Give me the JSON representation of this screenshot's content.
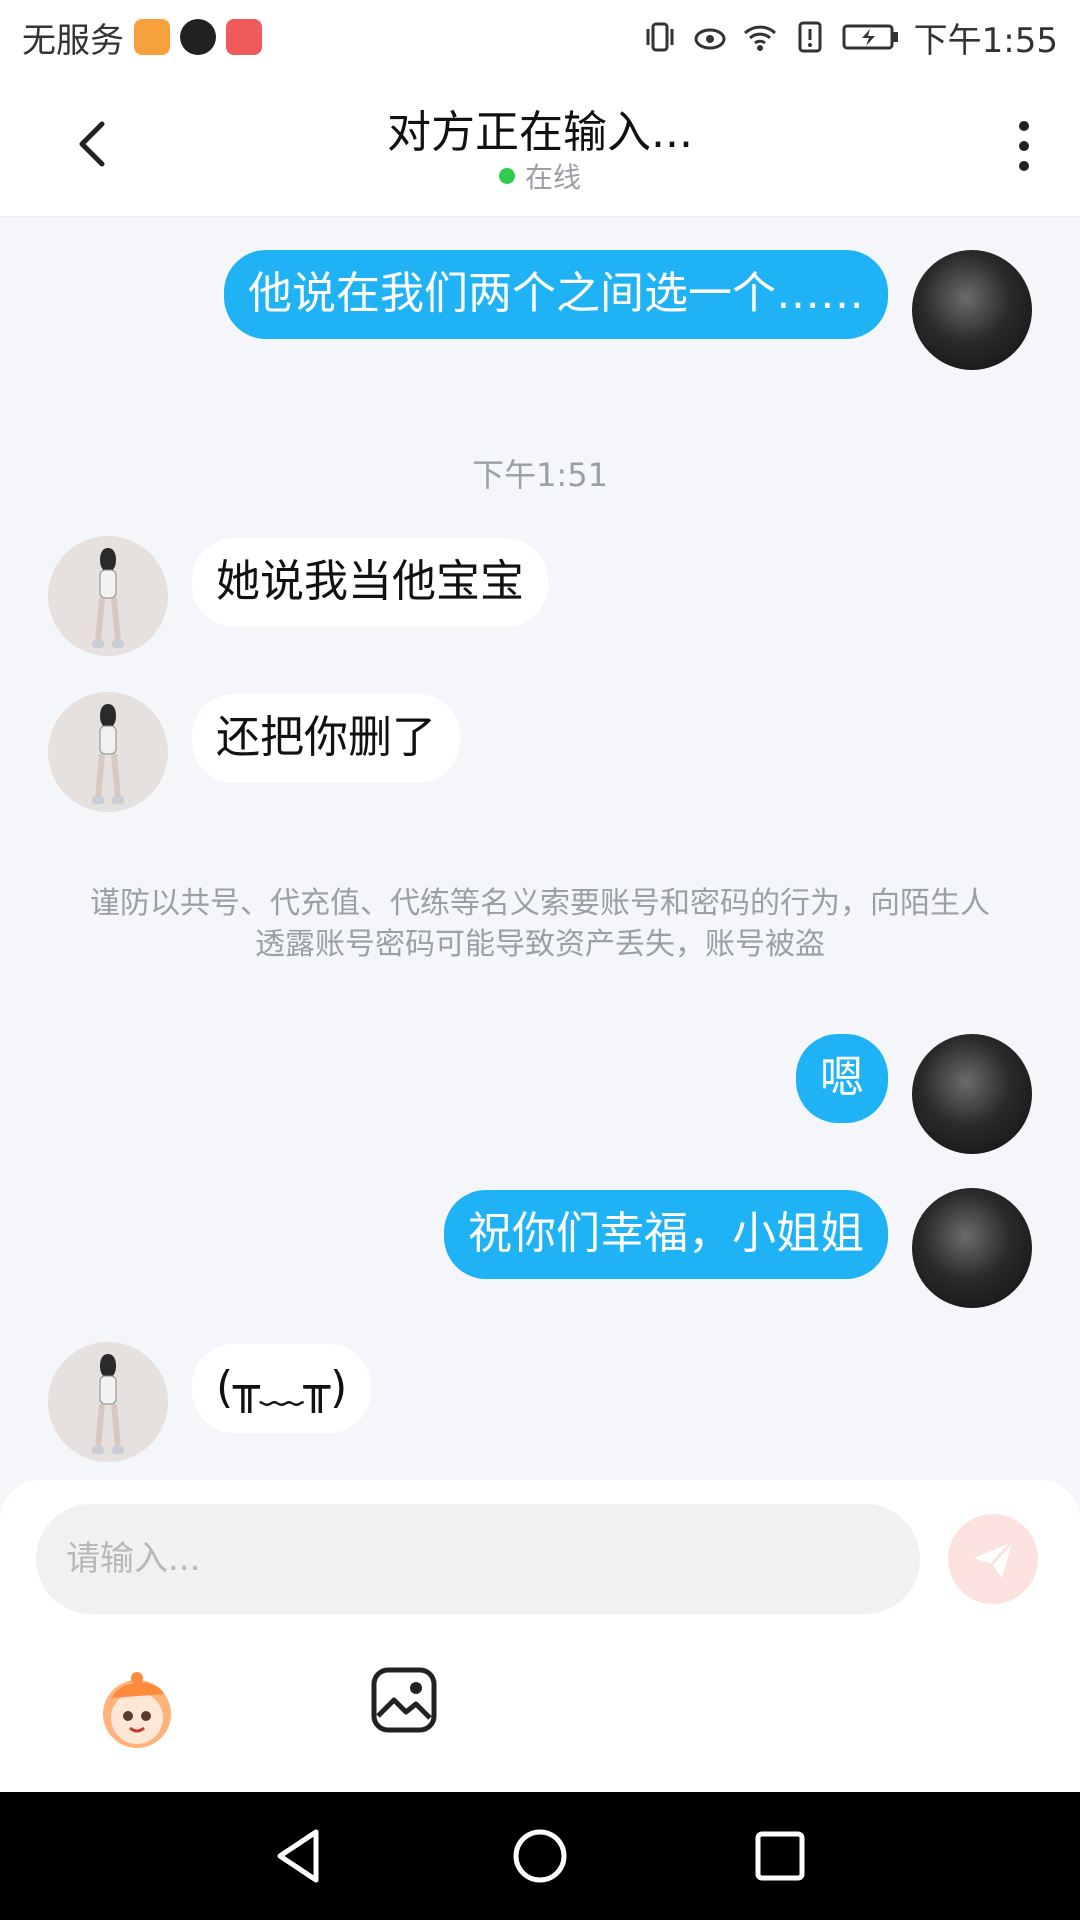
{
  "status_bar": {
    "carrier": "无服务",
    "time": "下午1:55",
    "icons": [
      "video-app-icon",
      "game-app-icon",
      "huawei-store-icon",
      "vibrate-icon",
      "eye-comfort-icon",
      "wifi-icon",
      "sim-alert-icon",
      "battery-icon"
    ]
  },
  "header": {
    "title": "对方正在输入...",
    "status_text": "在线",
    "status_color": "#2ecc4f"
  },
  "messages": [
    {
      "from": "me",
      "text": "他说在我们两个之间选一个……"
    },
    {
      "from": "system",
      "text": "下午1:51"
    },
    {
      "from": "other",
      "text": "她说我当他宝宝"
    },
    {
      "from": "other",
      "text": "还把你删了"
    },
    {
      "from": "system",
      "text": "谨防以共号、代充值、代练等名义索要账号和密码的行为，向陌生人透露账号密码可能导致资产丢失，账号被盗"
    },
    {
      "from": "me",
      "text": "嗯"
    },
    {
      "from": "me",
      "text": "祝你们幸福，小姐姐"
    },
    {
      "from": "other",
      "text": "(╥﹏╥)"
    }
  ],
  "input": {
    "placeholder": "请输入..."
  },
  "colors": {
    "my_bubble": "#1fb3f5",
    "other_bubble": "#ffffff",
    "background": "#f4f6f9",
    "send_button": "#fbe2de"
  }
}
